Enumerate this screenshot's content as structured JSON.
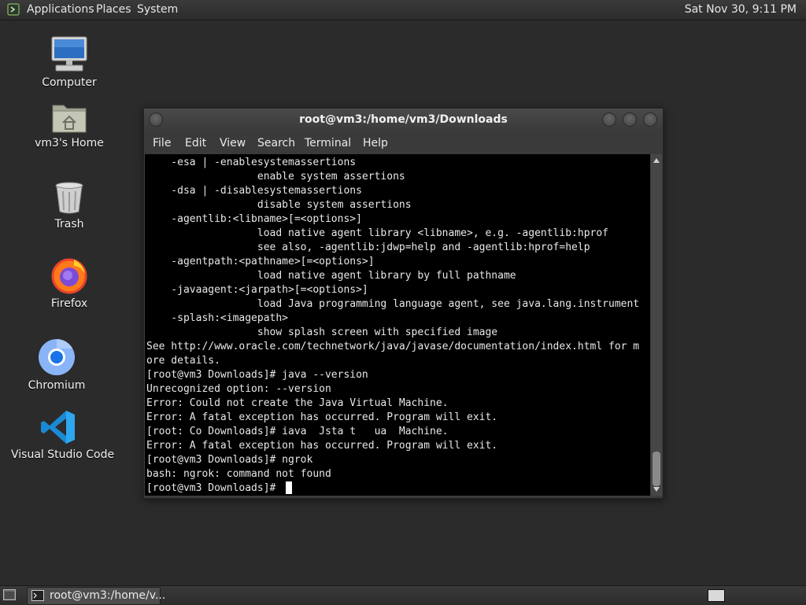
{
  "top_panel": {
    "menus": [
      "Applications",
      "Places",
      "System"
    ],
    "clock": "Sat Nov 30,  9:11 PM"
  },
  "desktop": {
    "icons": [
      {
        "label": "Computer",
        "icon": "computer-icon"
      },
      {
        "label": "vm3's Home",
        "icon": "home-folder-icon"
      },
      {
        "label": "Trash",
        "icon": "trash-icon"
      },
      {
        "label": "Firefox",
        "icon": "firefox-icon"
      },
      {
        "label": "Chromium",
        "icon": "chromium-icon"
      },
      {
        "label": "Visual Studio Code",
        "icon": "vscode-icon"
      }
    ]
  },
  "terminal": {
    "title": "root@vm3:/home/vm3/Downloads",
    "menu": [
      "File",
      "Edit",
      "View",
      "Search",
      "Terminal",
      "Help"
    ],
    "lines": [
      "    -esa | -enablesystemassertions",
      "                  enable system assertions",
      "    -dsa | -disablesystemassertions",
      "                  disable system assertions",
      "    -agentlib:<libname>[=<options>]",
      "                  load native agent library <libname>, e.g. -agentlib:hprof",
      "                  see also, -agentlib:jdwp=help and -agentlib:hprof=help",
      "    -agentpath:<pathname>[=<options>]",
      "                  load native agent library by full pathname",
      "    -javaagent:<jarpath>[=<options>]",
      "                  load Java programming language agent, see java.lang.instrument",
      "    -splash:<imagepath>",
      "                  show splash screen with specified image",
      "See http://www.oracle.com/technetwork/java/javase/documentation/index.html for m",
      "ore details.",
      "[root@vm3 Downloads]# java --version",
      "Unrecognized option: --version",
      "Error: Could not create the Java Virtual Machine.",
      "Error: A fatal exception has occurred. Program will exit.",
      "[root: Co Downloads]# iava  Jsta t   ua  Machine.",
      "Error: A fatal exception has occurred. Program will exit.",
      "[root@vm3 Downloads]# ngrok",
      "bash: ngrok: command not found",
      "[root@vm3 Downloads]# "
    ]
  },
  "taskbar": {
    "window_button_label": "root@vm3:/home/v..."
  },
  "colors": {
    "panel": "#333333",
    "desktop": "#2b2b2b",
    "terminal_bg": "#000000",
    "terminal_fg": "#e8e8e8"
  }
}
